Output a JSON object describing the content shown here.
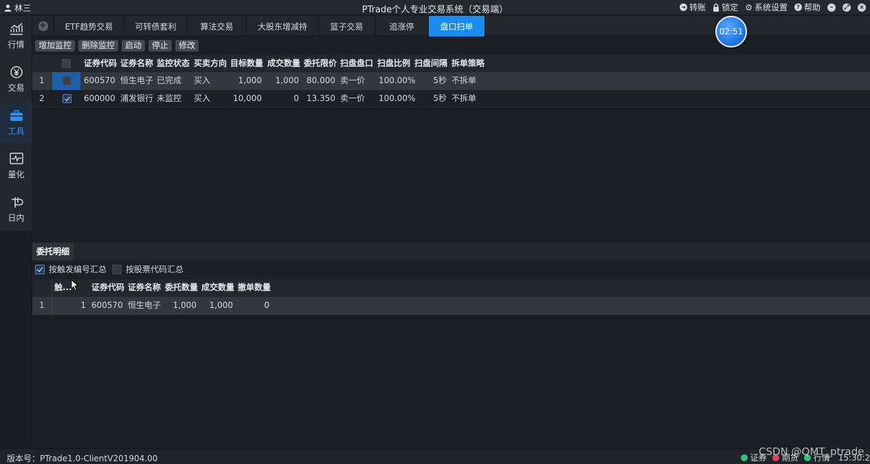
{
  "titlebar": {
    "user": "林三",
    "title": "PTrade个人专业交易系统（交易端）",
    "transfer": "转账",
    "lock": "锁定",
    "settings": "系统设置",
    "help": "帮助"
  },
  "nav": [
    {
      "label": "行情",
      "icon": "chart-line-icon"
    },
    {
      "label": "交易",
      "icon": "yen-circle-icon"
    },
    {
      "label": "工具",
      "icon": "toolbox-icon"
    },
    {
      "label": "量化",
      "icon": "pulse-monitor-icon"
    },
    {
      "label": "日内",
      "icon": "intraday-icon"
    }
  ],
  "tabs": [
    "ETF趋势交易",
    "可转债套利",
    "算法交易",
    "大股东增减持",
    "篮子交易",
    "追涨停",
    "盘口扫单"
  ],
  "active_tab": "盘口扫单",
  "clock": "02:51",
  "toolbar": {
    "add": "增加监控",
    "delete": "删除监控",
    "start": "启动",
    "stop": "停止",
    "modify": "修改"
  },
  "monitor_table": {
    "headers": [
      "证券代码",
      "证券名称",
      "监控状态",
      "买卖方向",
      "目标数量",
      "成交数量",
      "委托限价",
      "扫盘盘口",
      "扫盘比例",
      "扫盘间隔",
      "拆单策略"
    ],
    "rows": [
      {
        "index": "1",
        "checked": false,
        "code": "600570",
        "name": "恒生电子",
        "status": "已完成",
        "side": "买入",
        "target_qty": "1,000",
        "filled_qty": "1,000",
        "limit_price": "80.000",
        "level": "卖一价",
        "ratio": "100.00%",
        "interval": "5秒",
        "strategy": "不拆单"
      },
      {
        "index": "2",
        "checked": true,
        "code": "600000",
        "name": "浦发银行",
        "status": "未监控",
        "side": "买入",
        "target_qty": "10,000",
        "filled_qty": "0",
        "limit_price": "13.350",
        "level": "卖一价",
        "ratio": "100.00%",
        "interval": "5秒",
        "strategy": "不拆单"
      }
    ]
  },
  "detail_panel": {
    "tab": "委托明细",
    "opt_by_trigger": "按触发编号汇总",
    "opt_by_trigger_checked": true,
    "opt_by_code": "按股票代码汇总",
    "opt_by_code_checked": false,
    "headers": [
      "触...",
      "证券代码",
      "证券名称",
      "委托数量",
      "成交数量",
      "撤单数量"
    ],
    "rows": [
      {
        "index": "1",
        "trigger": "1",
        "code": "600570",
        "name": "恒生电子",
        "order_qty": "1,000",
        "filled_qty": "1,000",
        "cancel_qty": "0"
      }
    ]
  },
  "statusbar": {
    "version": "版本号：PTrade1.0-ClientV201904.00",
    "sec": "证券",
    "futures": "期货",
    "quote": "行情",
    "time": "15:30:2"
  },
  "watermark": "CSDN @QMT_ptrade",
  "colors": {
    "accent": "#1a8cf0",
    "green": "#2ec27e",
    "red": "#e0445a"
  }
}
